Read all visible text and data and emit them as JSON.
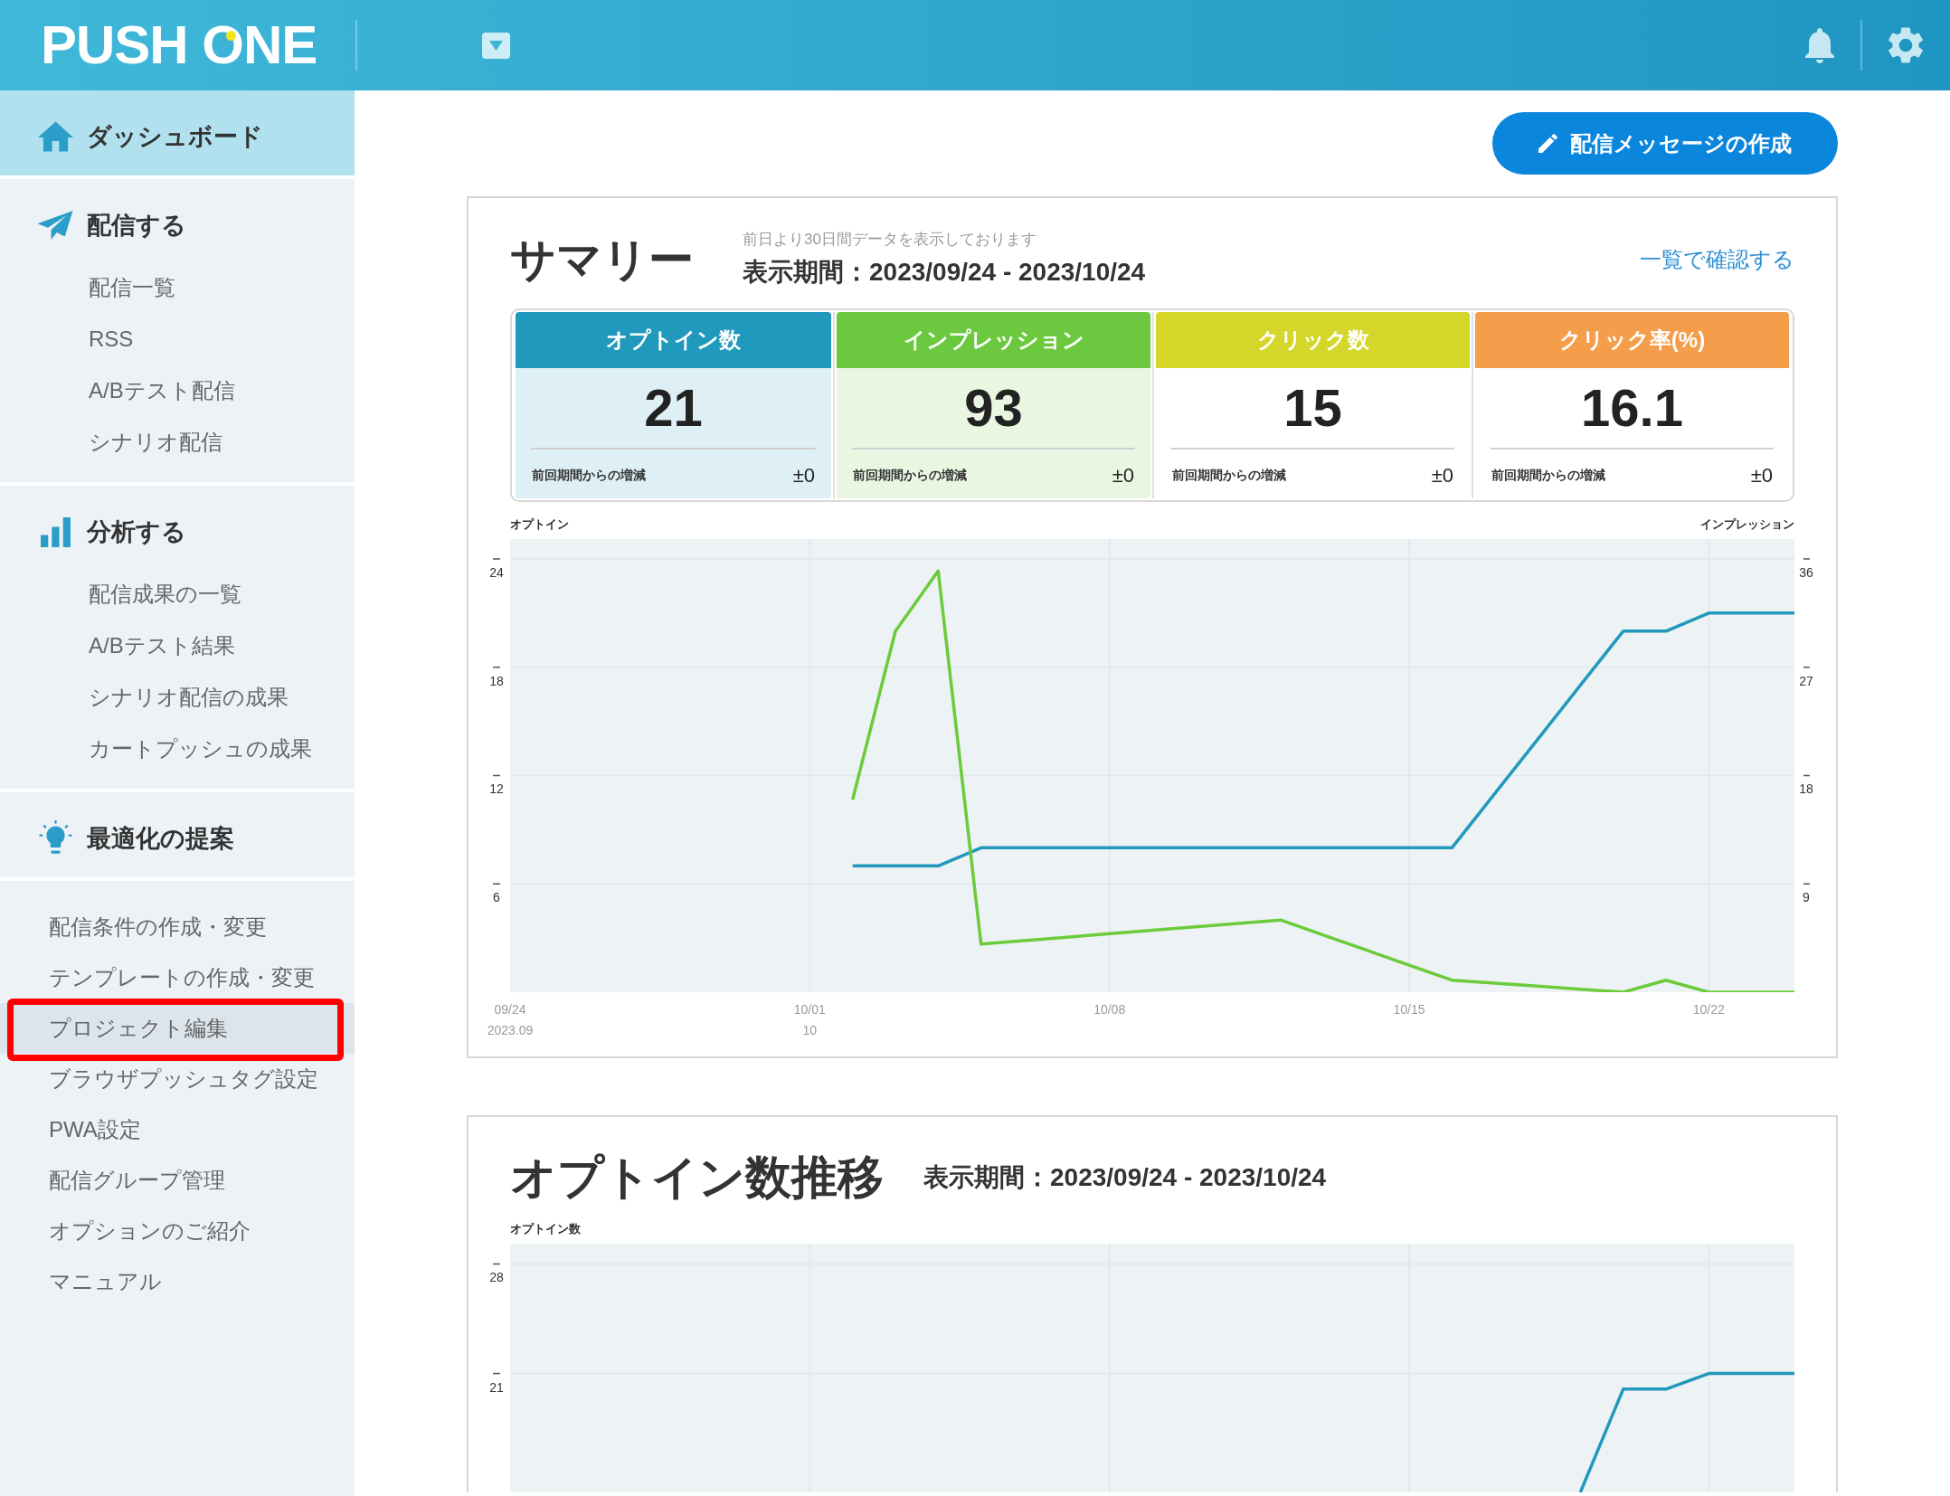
{
  "header": {
    "logo": "PUSH ONE"
  },
  "sidebar": {
    "sections": [
      {
        "label": "ダッシュボード",
        "selected": true
      },
      {
        "label": "配信する",
        "selected": false,
        "items": [
          {
            "label": "配信一覧",
            "selected": false
          },
          {
            "label": "RSS",
            "selected": false
          },
          {
            "label": "A/Bテスト配信",
            "selected": false
          },
          {
            "label": "シナリオ配信",
            "selected": false
          }
        ]
      },
      {
        "label": "分析する",
        "selected": false,
        "items": [
          {
            "label": "配信成果の一覧",
            "selected": false
          },
          {
            "label": "A/Bテスト結果",
            "selected": false
          },
          {
            "label": "シナリオ配信の成果",
            "selected": false
          },
          {
            "label": "カートプッシュの成果",
            "selected": false
          }
        ]
      },
      {
        "label": "最適化の提案",
        "selected": false
      }
    ],
    "settings_menu": [
      {
        "label": "配信条件の作成・変更",
        "selected": false,
        "highlighted": false
      },
      {
        "label": "テンプレートの作成・変更",
        "selected": false,
        "highlighted": false
      },
      {
        "label": "プロジェクト編集",
        "selected": true,
        "highlighted": true
      },
      {
        "label": "ブラウザプッシュタグ設定",
        "selected": false,
        "highlighted": false
      },
      {
        "label": "PWA設定",
        "selected": false,
        "highlighted": false
      },
      {
        "label": "配信グループ管理",
        "selected": false,
        "highlighted": false
      },
      {
        "label": "オプションのご紹介",
        "selected": false,
        "highlighted": false
      },
      {
        "label": "マニュアル",
        "selected": false,
        "highlighted": false
      }
    ]
  },
  "create_button": {
    "label": "配信メッセージの作成"
  },
  "summary": {
    "title": "サマリー",
    "note": "前日より30日間データを表示しております",
    "period": "表示期間：2023/09/24 - 2023/10/24",
    "link": "一覧で確認する",
    "cards": [
      {
        "label": "オプトイン数",
        "value": "21",
        "change_label": "前回期間からの増減",
        "change": "±0",
        "color": "#2199bc",
        "selected": true
      },
      {
        "label": "インプレッション",
        "value": "93",
        "change_label": "前回期間からの増減",
        "change": "±0",
        "color": "#6cc93f",
        "selected": true
      },
      {
        "label": "クリック数",
        "value": "15",
        "change_label": "前回期間からの増減",
        "change": "±0",
        "color": "#d4d62a",
        "selected": false
      },
      {
        "label": "クリック率(%)",
        "value": "16.1",
        "change_label": "前回期間からの増減",
        "change": "±0",
        "color": "#f49e4b",
        "selected": false
      }
    ],
    "chart_data": {
      "type": "line",
      "grid": true,
      "ylabel": "オプトイン",
      "y2label": "インプレッション",
      "categories": [
        "09/24",
        null,
        null,
        null,
        null,
        null,
        null,
        "10/01",
        null,
        null,
        null,
        null,
        null,
        null,
        "10/08",
        null,
        null,
        null,
        null,
        null,
        null,
        "10/15",
        null,
        null,
        null,
        null,
        null,
        null,
        "10/22",
        null,
        null
      ],
      "ylim": [
        0,
        25.1
      ],
      "yticks": [
        6,
        12,
        18,
        24
      ],
      "y2lim": [
        0,
        37.65
      ],
      "y2ticks": [
        9,
        18,
        27,
        36
      ],
      "annotations": [
        "2023.09",
        "10"
      ],
      "series": [
        {
          "color": "#2199bd",
          "values": [
            null,
            null,
            null,
            null,
            null,
            null,
            null,
            null,
            7,
            7,
            7,
            8,
            8,
            8,
            8,
            8,
            8,
            8,
            8,
            8,
            8,
            8,
            8,
            11,
            14,
            17,
            20,
            20,
            21,
            21,
            21
          ]
        },
        {
          "color": "#6ccb3a",
          "axis": "y2",
          "values": [
            null,
            null,
            null,
            null,
            null,
            null,
            null,
            null,
            16,
            30,
            35,
            4,
            4.29,
            4.57,
            4.86,
            5.14,
            5.43,
            5.71,
            6,
            4.75,
            3.5,
            2.25,
            1,
            0.75,
            0.5,
            0.25,
            0,
            1,
            0,
            0,
            0
          ]
        }
      ]
    }
  },
  "optin_trend": {
    "title": "オプトイン数推移",
    "period": "表示期間：2023/09/24 - 2023/10/24",
    "chart_data": {
      "type": "line",
      "grid": true,
      "ylabel": "オプトイン数",
      "categories": [
        null,
        null,
        null,
        null,
        null,
        null,
        null,
        null,
        null,
        null,
        null,
        null,
        null,
        null,
        null,
        null,
        null,
        null,
        null,
        null,
        null,
        null,
        null,
        null,
        null,
        null,
        null,
        null,
        null,
        null,
        null
      ],
      "ylim": [
        13.4,
        29.3
      ],
      "yticks": [
        21,
        28
      ],
      "series": [
        {
          "color": "#2199bd",
          "values": [
            null,
            null,
            null,
            null,
            null,
            null,
            null,
            null,
            null,
            null,
            null,
            null,
            null,
            null,
            null,
            null,
            null,
            null,
            null,
            null,
            null,
            null,
            null,
            null,
            null,
            13.4,
            20,
            20,
            21,
            21,
            21
          ]
        }
      ]
    }
  }
}
